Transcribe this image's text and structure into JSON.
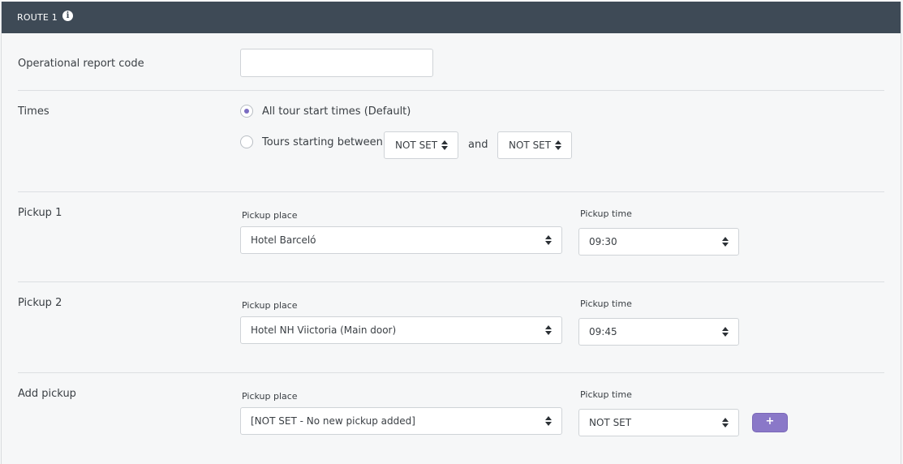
{
  "header": {
    "title": "ROUTE 1",
    "info_icon": "info-icon"
  },
  "operational_report": {
    "label": "Operational report code",
    "value": "",
    "placeholder": ""
  },
  "times": {
    "label": "Times",
    "option_default": "All tour start times (Default)",
    "option_between": "Tours starting between",
    "selected": "default",
    "from": "NOT SET",
    "and_label": "and",
    "to": "NOT SET"
  },
  "pickups": [
    {
      "label": "Pickup 1",
      "place_label": "Pickup place",
      "place": "Hotel Barceló",
      "time_label": "Pickup time",
      "time": "09:30"
    },
    {
      "label": "Pickup 2",
      "place_label": "Pickup place",
      "place": "Hotel NH Viictoria (Main door)",
      "time_label": "Pickup time",
      "time": "09:45"
    }
  ],
  "add_pickup": {
    "label": "Add pickup",
    "place_label": "Pickup place",
    "place": "[NOT SET - No new pickup added]",
    "time_label": "Pickup time",
    "time": "NOT SET",
    "button_label": "+"
  },
  "colors": {
    "header_bg": "#3e4a56",
    "accent": "#7b6cc2",
    "button": "#8a78c8"
  }
}
